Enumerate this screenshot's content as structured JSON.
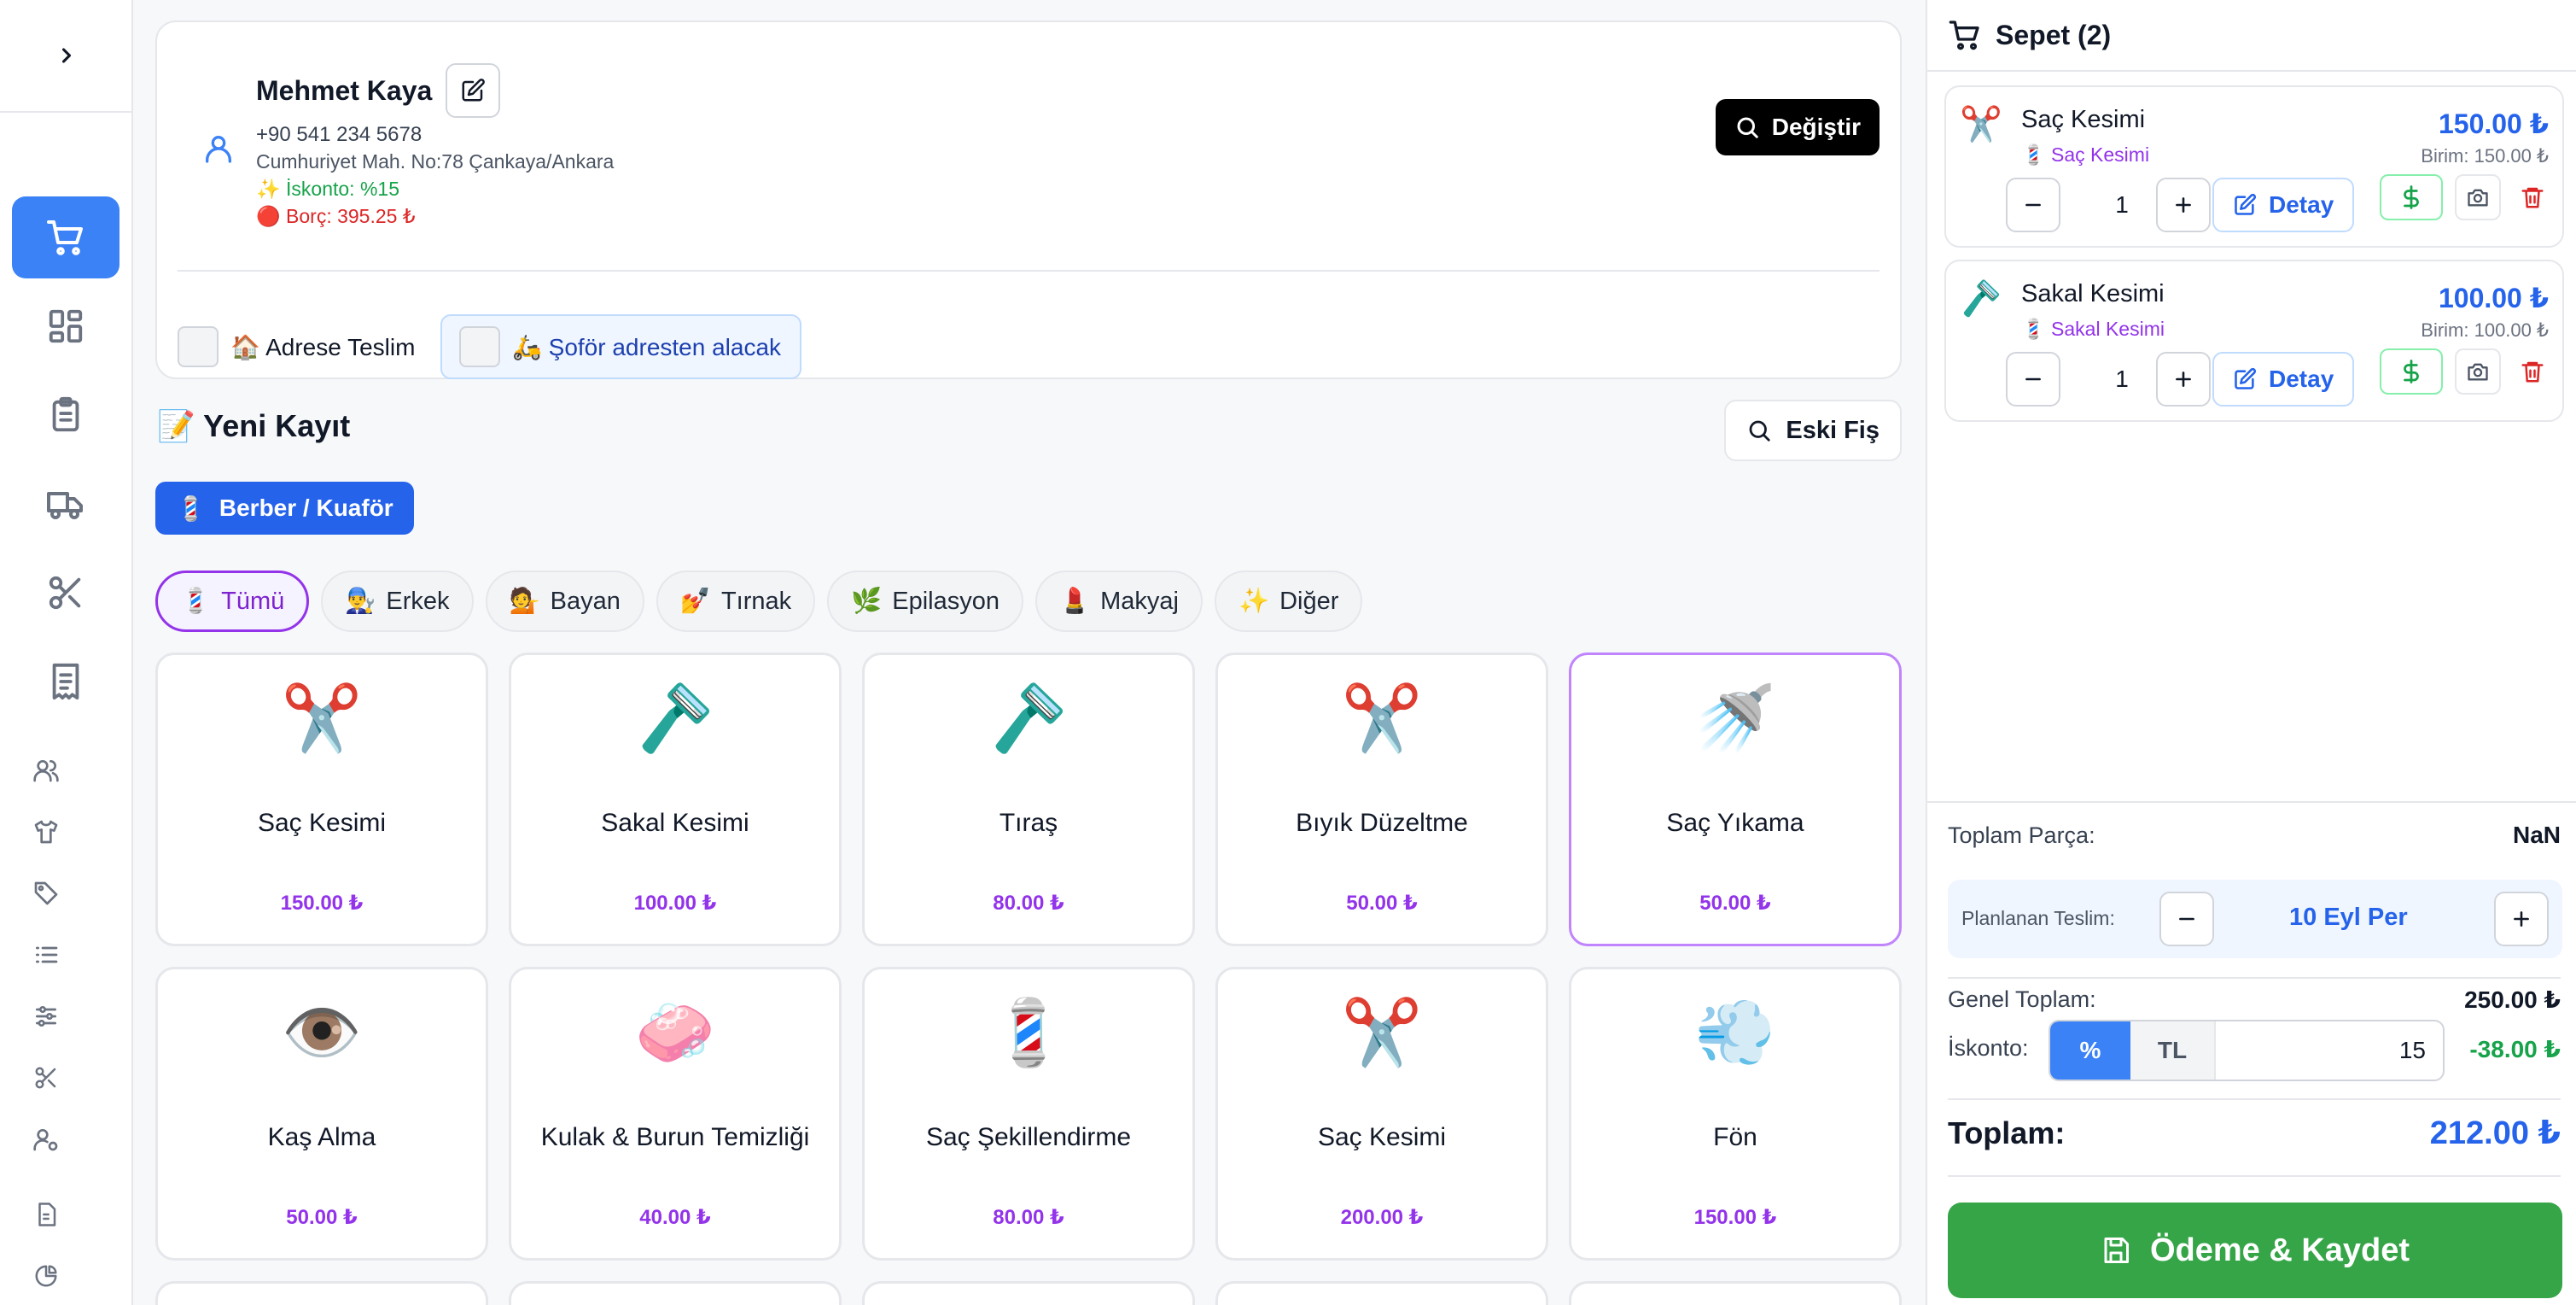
{
  "customer": {
    "name": "Mehmet Kaya",
    "phone": "+90 541 234 5678",
    "address": "Cumhuriyet Mah. No:78 Çankaya/Ankara",
    "discount": "✨ İskonto: %15",
    "debt": "🔴 Borç: 395.25 ₺",
    "change_label": "Değiştir",
    "delivery_to_address": "🏠 Adrese Teslim",
    "driver_pickup": "🛵 Şoför adresten alacak"
  },
  "new_record": {
    "title": "📝 Yeni Kayıt",
    "old_receipt_label": "Eski Fiş",
    "sector_icon": "💈",
    "sector_label": "Berber / Kuaför"
  },
  "categories": [
    {
      "icon": "💈",
      "label": "Tümü"
    },
    {
      "icon": "👨‍🔧",
      "label": "Erkek"
    },
    {
      "icon": "💁",
      "label": "Bayan"
    },
    {
      "icon": "💅",
      "label": "Tırnak"
    },
    {
      "icon": "🌿",
      "label": "Epilasyon"
    },
    {
      "icon": "💄",
      "label": "Makyaj"
    },
    {
      "icon": "✨",
      "label": "Diğer"
    }
  ],
  "services": [
    {
      "icon": "✂️",
      "name": "Saç Kesimi",
      "price": "150.00 ₺"
    },
    {
      "icon": "🪒",
      "name": "Sakal Kesimi",
      "price": "100.00 ₺"
    },
    {
      "icon": "🪒",
      "name": "Tıraş",
      "price": "80.00 ₺"
    },
    {
      "icon": "✂️",
      "name": "Bıyık Düzeltme",
      "price": "50.00 ₺"
    },
    {
      "icon": "🚿",
      "name": "Saç Yıkama",
      "price": "50.00 ₺"
    },
    {
      "icon": "👁️",
      "name": "Kaş Alma",
      "price": "50.00 ₺"
    },
    {
      "icon": "🧼",
      "name": "Kulak & Burun Temizliği",
      "price": "40.00 ₺"
    },
    {
      "icon": "💈",
      "name": "Saç Şekillendirme",
      "price": "80.00 ₺"
    },
    {
      "icon": "✂️",
      "name": "Saç Kesimi",
      "price": "200.00 ₺"
    },
    {
      "icon": "💨",
      "name": "Fön",
      "price": "150.00 ₺"
    }
  ],
  "cart": {
    "title": "Sepet (2)",
    "items": [
      {
        "icon": "✂️",
        "name": "Saç Kesimi",
        "sector": "💈 Saç Kesimi",
        "price": "150.00 ₺",
        "unit": "Birim: 150.00 ₺",
        "qty": "1",
        "detail_label": "Detay"
      },
      {
        "icon": "🪒",
        "name": "Sakal Kesimi",
        "sector": "💈 Sakal Kesimi",
        "price": "100.00 ₺",
        "unit": "Birim: 100.00 ₺",
        "qty": "1",
        "detail_label": "Detay"
      }
    ],
    "summary": {
      "total_parts_label": "Toplam Parça:",
      "total_parts_value": "NaN",
      "planned_label": "Planlanan Teslim:",
      "planned_date": "10 Eyl Per",
      "grand_total_label": "Genel Toplam:",
      "grand_total_value": "250.00 ₺",
      "discount_label": "İskonto:",
      "discount_pct": "%",
      "discount_tl": "TL",
      "discount_input": "15",
      "discount_amount": "-38.00 ₺",
      "total_label": "Toplam:",
      "total_value": "212.00 ₺",
      "pay_label": "Ödeme & Kaydet"
    }
  },
  "colors": {
    "accent": "#3b82f6",
    "primary": "#2563eb",
    "purple": "#9333ea",
    "success": "#36a548",
    "danger": "#dc2626"
  }
}
